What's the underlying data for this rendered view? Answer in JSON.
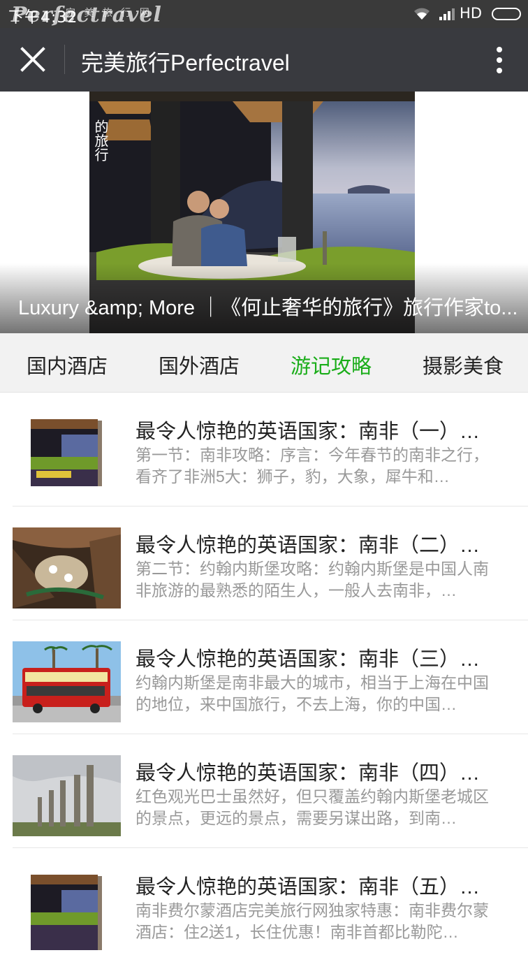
{
  "status_bar": {
    "time": "下午4:32",
    "network": "HD"
  },
  "watermark": {
    "cn": "完 美 旅 行 网",
    "en": "Perfectravel"
  },
  "top_bar": {
    "title": "完美旅行Perfectravel"
  },
  "banner": {
    "caption": "Luxury &amp; More ｜《何止奢华的旅行》旅行作家to...",
    "cover_text": "的旅行"
  },
  "tabs": [
    {
      "label": "国内酒店",
      "active": false
    },
    {
      "label": "国外酒店",
      "active": false
    },
    {
      "label": "游记攻略",
      "active": true
    },
    {
      "label": "摄影美食",
      "active": false
    }
  ],
  "articles": [
    {
      "title": "最令人惊艳的英语国家：南非（一）…",
      "desc": "第一节：南非攻略：序言：今年春节的南非之行，看齐了非洲5大：狮子，豹，大象，犀牛和…",
      "thumb": "book-cover"
    },
    {
      "title": "最令人惊艳的英语国家：南非（二）…",
      "desc": "第二节：约翰内斯堡攻略：约翰内斯堡是中国人南非旅游的最熟悉的陌生人，一般人去南非，…",
      "thumb": "hotel-lobby"
    },
    {
      "title": "最令人惊艳的英语国家：南非（三）…",
      "desc": "约翰内斯堡是南非最大的城市，相当于上海在中国的地位，来中国旅行，不去上海，你的中国…",
      "thumb": "red-bus"
    },
    {
      "title": "最令人惊艳的英语国家：南非（四）…",
      "desc": "红色观光巴士虽然好，但只覆盖约翰内斯堡老城区的景点，更远的景点，需要另谋出路，到南…",
      "thumb": "pillars"
    },
    {
      "title": "最令人惊艳的英语国家：南非（五）…",
      "desc": "南非费尔蒙酒店完美旅行网独家特惠：南非费尔蒙酒店：住2送1，长住优惠！南非首都比勒陀…",
      "thumb": "book-cover"
    }
  ],
  "colors": {
    "accent": "#1aad19",
    "top_bar": "#393a3f",
    "status_bar": "#3a3a3a"
  }
}
